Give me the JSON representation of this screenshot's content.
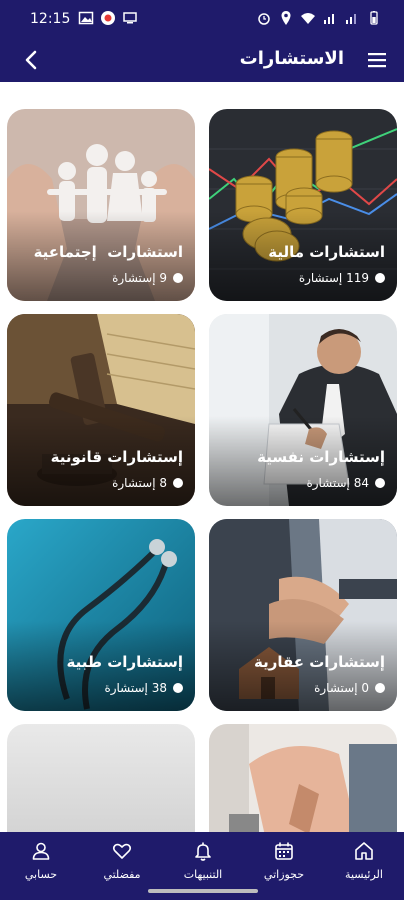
{
  "status_bar": {
    "time": "12:15"
  },
  "app_bar": {
    "title": "الاستشارات"
  },
  "cards": [
    {
      "title": "استشارات مالية",
      "count": "119 إستشارة",
      "image": "coins-chart"
    },
    {
      "title": "استشارات  إجتماعية",
      "count": "9 إستشارة",
      "image": "family-hands"
    },
    {
      "title": "إستشارات نفسية",
      "count": "84 إستشارة",
      "image": "stressed-man"
    },
    {
      "title": "إستشارات قانونية",
      "count": "8 إستشارة",
      "image": "gavel-books"
    },
    {
      "title": "إستشارات عقارية",
      "count": "0 إستشارة",
      "image": "handshake-house"
    },
    {
      "title": "إستشارات طبية",
      "count": "38 إستشارة",
      "image": "stethoscope"
    },
    {
      "title": "",
      "count": "",
      "image": "craftsman"
    },
    {
      "title": "",
      "count": "",
      "image": "blank-grey"
    }
  ],
  "bottom_nav": [
    {
      "label": "الرئيسية",
      "icon": "home-icon"
    },
    {
      "label": "حجوزاتي",
      "icon": "calendar-icon"
    },
    {
      "label": "التنبيهات",
      "icon": "bell-icon"
    },
    {
      "label": "مفضلتي",
      "icon": "heart-icon"
    },
    {
      "label": "حسابي",
      "icon": "user-icon"
    }
  ],
  "colors": {
    "primary": "#1f1b6b",
    "background": "#ffffff"
  }
}
